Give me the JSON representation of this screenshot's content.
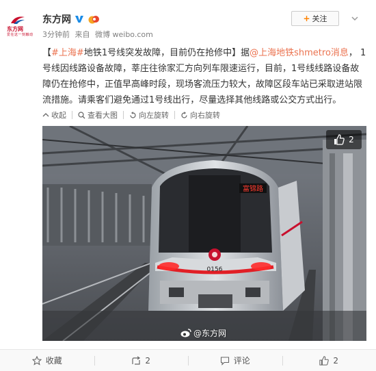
{
  "user": {
    "name": "东方网",
    "logo_text": "东方网",
    "logo_sub": "爱在这一刻触动",
    "time": "3分钟前",
    "source_prefix": "来自",
    "source": "微博 weibo.com"
  },
  "follow_label": "关注",
  "post": {
    "topic": "#上海#",
    "title": "地铁1号线突发故障，目前仍在抢修中",
    "mid": "】据",
    "mention": "@上海地铁shmetro消息",
    "text": "， 1号线因线路设备故障，莘庄往徐家汇方向列车限速运行，目前，1号线线路设备故障仍在抢修中，正值早高峰时段，现场客流压力较大，故障区段车站已采取进站限流措施。请乘客们避免通过1号线出行，尽量选择其他线路或公交方式出行。"
  },
  "actions": {
    "collapse": "收起",
    "view_large": "查看大图",
    "rotate_left": "向左旋转",
    "rotate_right": "向右旋转"
  },
  "photo": {
    "like_count": "2",
    "train_number": "0156",
    "destination_sign": "富锦路",
    "watermark": "@东方网"
  },
  "footer": {
    "favorite": "收藏",
    "repost": "2",
    "comment": "评论",
    "like": "2"
  },
  "colors": {
    "link": "#eb7350",
    "accent": "#ff8200",
    "brand_red": "#c8102e"
  }
}
